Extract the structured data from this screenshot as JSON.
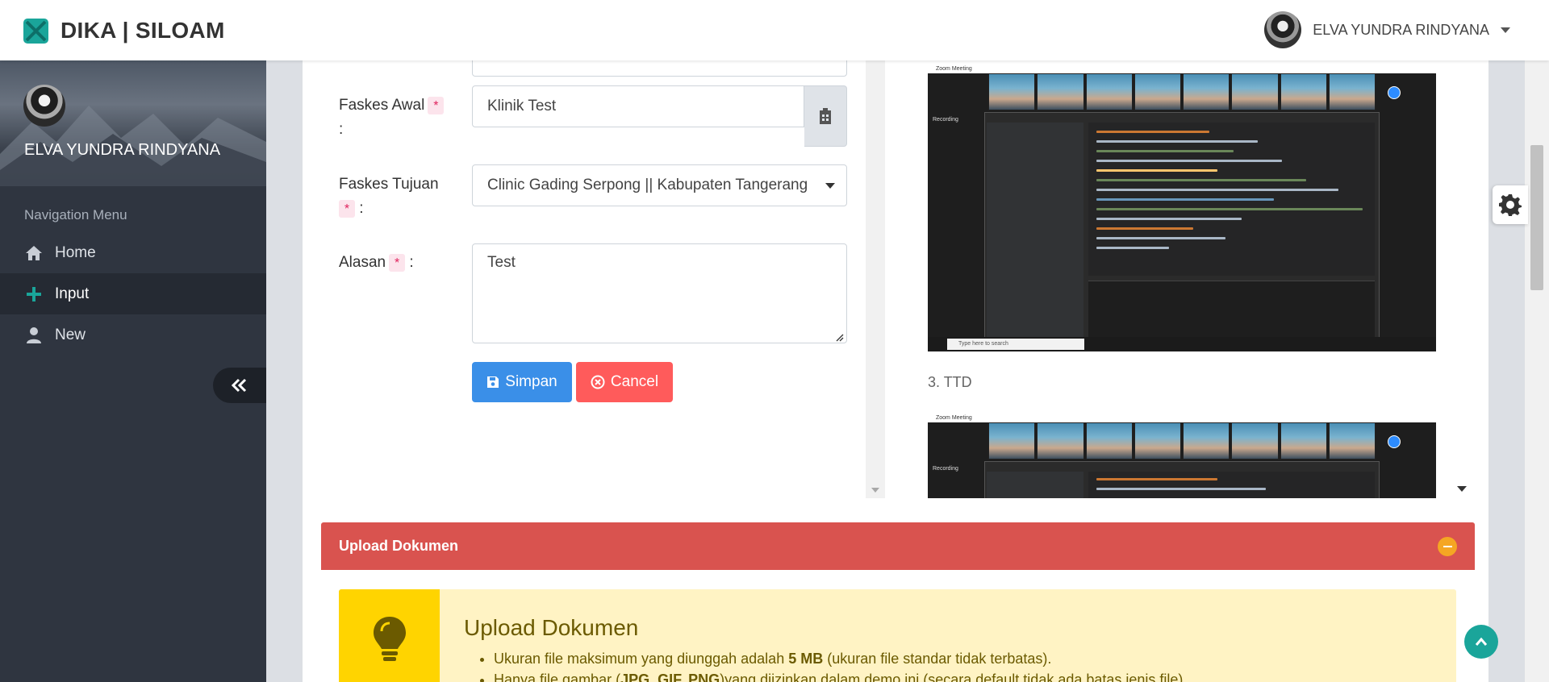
{
  "navbar": {
    "brand": "DIKA | SILOAM",
    "user_name": "ELVA YUNDRA RINDYANA",
    "accent": "#1aa59a"
  },
  "sidebar": {
    "user_name": "ELVA YUNDRA RINDYANA",
    "heading": "Navigation Menu",
    "items": [
      {
        "label": "Home",
        "icon": "home-icon"
      },
      {
        "label": "Input",
        "icon": "plus-icon",
        "active": true
      },
      {
        "label": "New",
        "icon": "user-icon"
      }
    ]
  },
  "form": {
    "faskes_awal_label": "Faskes Awal",
    "faskes_awal_value": "Klinik Test",
    "faskes_tujuan_label": "Faskes Tujuan",
    "faskes_tujuan_value": "Clinic Gading Serpong || Kabupaten Tangerang",
    "alasan_label": "Alasan",
    "alasan_value": "Test",
    "required_mark": "*",
    "colon": ":",
    "save_label": "Simpan",
    "cancel_label": "Cancel"
  },
  "preview": {
    "caption": "3. TTD",
    "zoom_title": "Zoom Meeting",
    "recording": "Recording",
    "taskbar_search": "Type here to search"
  },
  "upload": {
    "header_title": "Upload Dokumen",
    "callout_title": "Upload Dokumen",
    "bullet1_prefix": "Ukuran file maksimum yang diunggah adalah ",
    "bullet1_bold": "5 MB",
    "bullet1_suffix": " (ukuran file standar tidak terbatas).",
    "bullet2_prefix": "Hanya file gambar (",
    "bullet2_bold": "JPG, GIF, PNG",
    "bullet2_suffix": ")yang diizinkan dalam demo ini (secara default tidak ada batas jenis file)."
  }
}
